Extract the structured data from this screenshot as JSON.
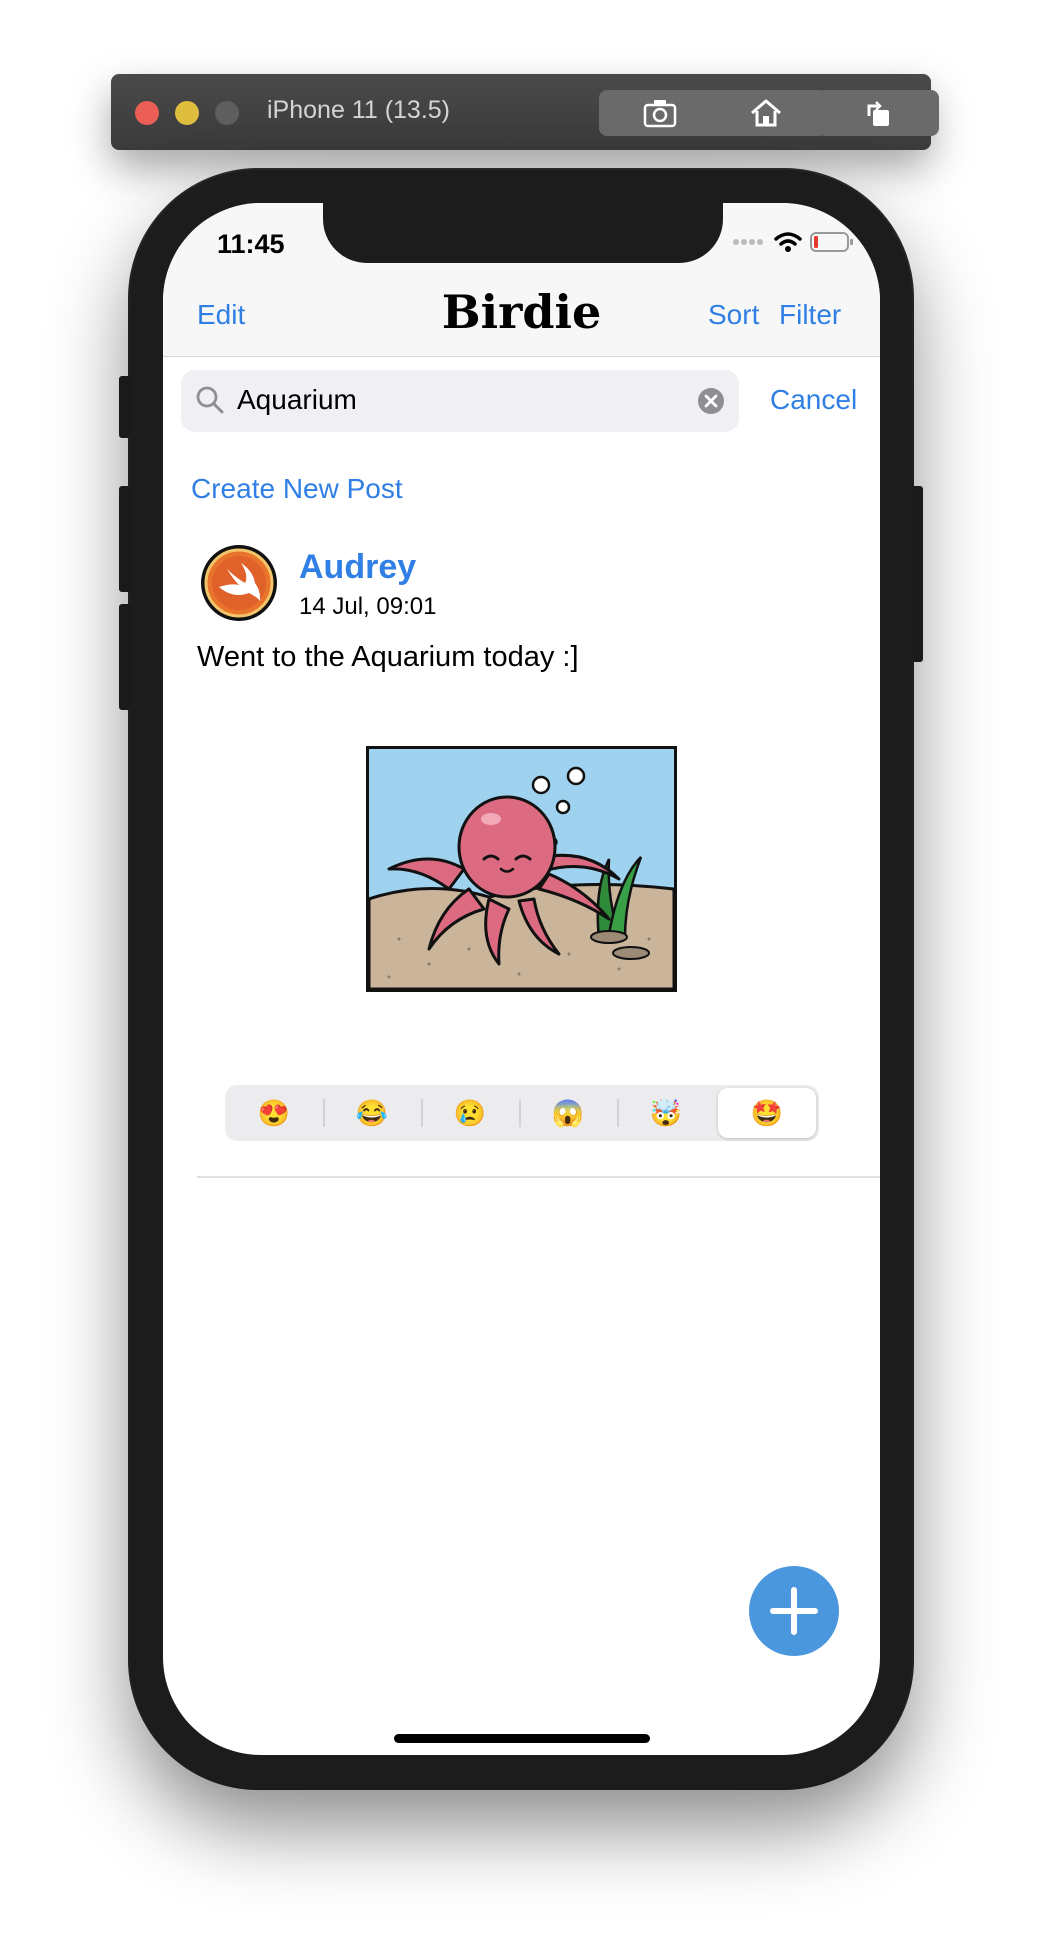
{
  "simulator": {
    "title": "iPhone 11 (13.5)",
    "buttons": [
      "screenshot-icon",
      "home-icon",
      "rotate-icon"
    ]
  },
  "status_bar": {
    "time": "11:45",
    "icons": [
      "signal-icon",
      "wifi-icon",
      "battery-icon"
    ]
  },
  "nav": {
    "title": "Birdie",
    "edit_label": "Edit",
    "sort_label": "Sort",
    "filter_label": "Filter"
  },
  "search": {
    "value": "Aquarium",
    "cancel_label": "Cancel"
  },
  "create_post_label": "Create New Post",
  "post": {
    "author": "Audrey",
    "date": "14 Jul, 09:01",
    "text": "Went to the Aquarium today :]",
    "image": "octopus-aquarium-illustration",
    "reactions": [
      {
        "emoji": "😍",
        "name": "heart-eyes"
      },
      {
        "emoji": "😂",
        "name": "laughing"
      },
      {
        "emoji": "😢",
        "name": "crying"
      },
      {
        "emoji": "😱",
        "name": "screaming"
      },
      {
        "emoji": "🤯",
        "name": "mind-blown"
      },
      {
        "emoji": "🤩",
        "name": "star-struck"
      }
    ],
    "selected_reaction": "star-struck"
  },
  "colors": {
    "accent": "#2f7fe4",
    "fab": "#4a97dd"
  }
}
